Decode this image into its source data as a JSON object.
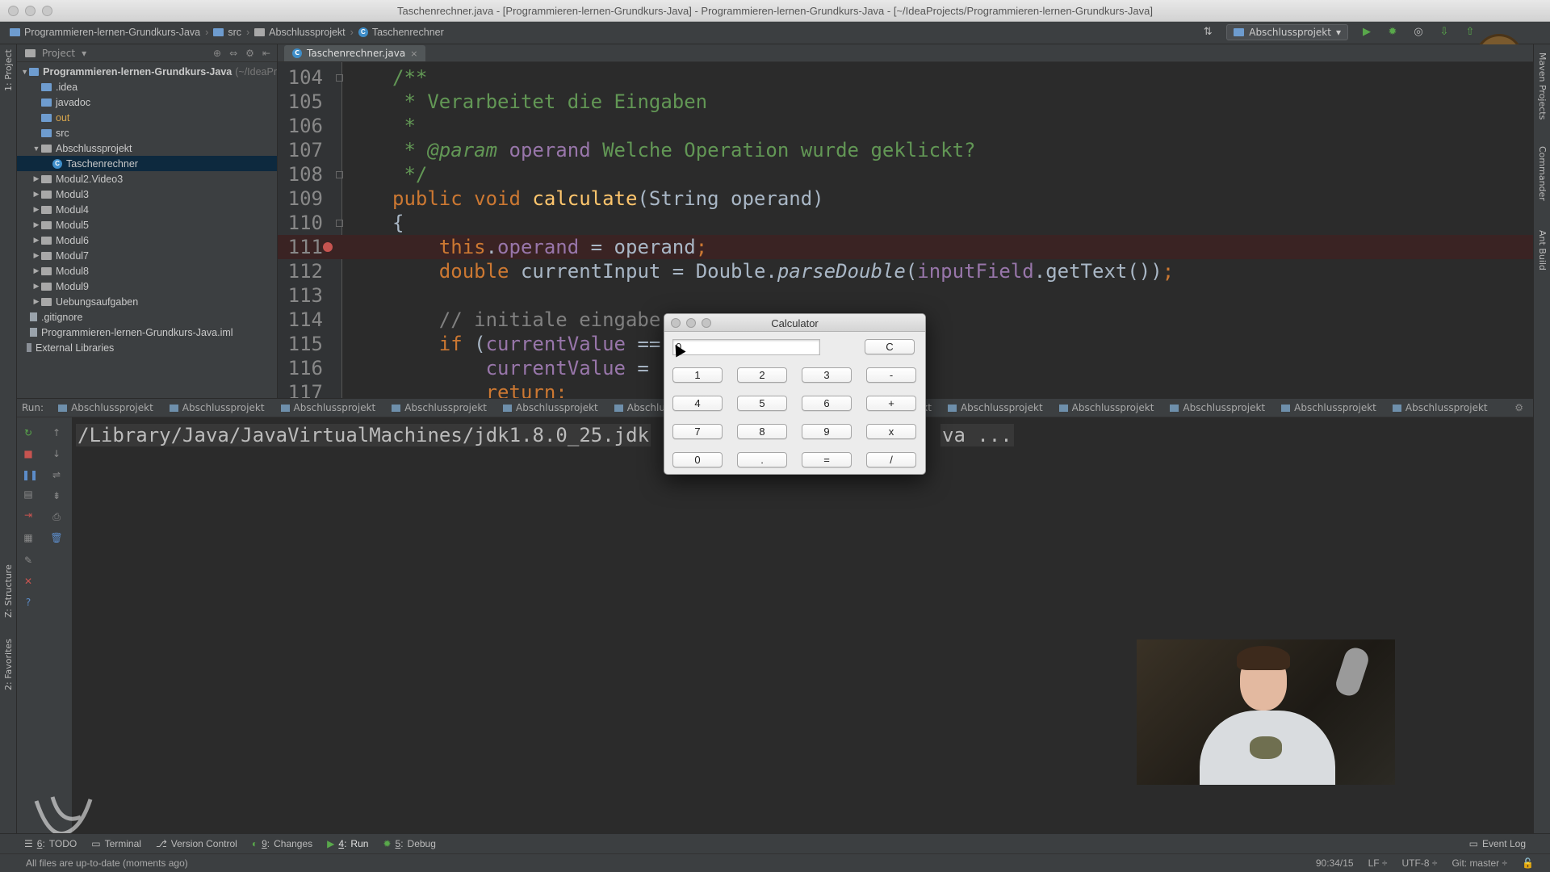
{
  "window": {
    "title": "Taschenrechner.java - [Programmieren-lernen-Grundkurs-Java] - Programmieren-lernen-Grundkurs-Java - [~/IdeaProjects/Programmieren-lernen-Grundkurs-Java]"
  },
  "navbar": {
    "breadcrumbs": [
      "Programmieren-lernen-Grundkurs-Java",
      "src",
      "Abschlussprojekt",
      "Taschenrechner"
    ],
    "run_config": "Abschlussprojekt"
  },
  "tool_strips": {
    "left_top": "1: Project",
    "left_structure": "Z: Structure",
    "left_favorites": "2: Favorites",
    "right": [
      "Maven Projects",
      "Commander",
      "Ant Build"
    ]
  },
  "project_panel": {
    "header": "Project",
    "tree": [
      {
        "label": "Programmieren-lernen-Grundkurs-Java",
        "suffix": "(~/IdeaPr",
        "level": 0,
        "icon": "folder-icon",
        "arrow": "▼"
      },
      {
        "label": ".idea",
        "level": 1,
        "icon": "folder-icon",
        "arrow": ""
      },
      {
        "label": "javadoc",
        "level": 1,
        "icon": "folder-icon",
        "arrow": ""
      },
      {
        "label": "out",
        "level": 1,
        "icon": "folder-icon",
        "arrow": ""
      },
      {
        "label": "src",
        "level": 1,
        "icon": "folder-icon",
        "arrow": ""
      },
      {
        "label": "Abschlussprojekt",
        "level": 1,
        "icon": "package-icon",
        "arrow": "▼"
      },
      {
        "label": "Taschenrechner",
        "level": 2,
        "icon": "class-icon",
        "arrow": "",
        "selected": true
      },
      {
        "label": "Modul2.Video3",
        "level": 1,
        "icon": "package-icon",
        "arrow": "▶"
      },
      {
        "label": "Modul3",
        "level": 1,
        "icon": "package-icon",
        "arrow": "▶"
      },
      {
        "label": "Modul4",
        "level": 1,
        "icon": "package-icon",
        "arrow": "▶"
      },
      {
        "label": "Modul5",
        "level": 1,
        "icon": "package-icon",
        "arrow": "▶"
      },
      {
        "label": "Modul6",
        "level": 1,
        "icon": "package-icon",
        "arrow": "▶"
      },
      {
        "label": "Modul7",
        "level": 1,
        "icon": "package-icon",
        "arrow": "▶"
      },
      {
        "label": "Modul8",
        "level": 1,
        "icon": "package-icon",
        "arrow": "▶"
      },
      {
        "label": "Modul9",
        "level": 1,
        "icon": "package-icon",
        "arrow": "▶"
      },
      {
        "label": "Uebungsaufgaben",
        "level": 1,
        "icon": "package-icon",
        "arrow": "▶"
      },
      {
        "label": ".gitignore",
        "level": 0,
        "icon": "file-icon",
        "arrow": ""
      },
      {
        "label": "Programmieren-lernen-Grundkurs-Java.iml",
        "level": 0,
        "icon": "file-icon",
        "arrow": ""
      },
      {
        "label": "External Libraries",
        "level": -1,
        "icon": "library-icon",
        "arrow": ""
      }
    ]
  },
  "editor": {
    "tab": "Taschenrechner.java",
    "lines": [
      {
        "num": "104",
        "indent": "",
        "fold": true,
        "segments": [
          [
            "c-doc",
            "/**"
          ]
        ]
      },
      {
        "num": "105",
        "indent": " ",
        "fold": false,
        "segments": [
          [
            "c-doc",
            "* Verarbeitet die Eingaben"
          ]
        ]
      },
      {
        "num": "106",
        "indent": " ",
        "fold": false,
        "segments": [
          [
            "c-doc",
            "*"
          ]
        ]
      },
      {
        "num": "107",
        "indent": " ",
        "fold": false,
        "segments": [
          [
            "c-doc",
            "* "
          ],
          [
            "c-doc it",
            "@param"
          ],
          [
            "fld",
            " operand"
          ],
          [
            "c-doc",
            " Welche Operation wurde geklickt?"
          ]
        ]
      },
      {
        "num": "108",
        "indent": " ",
        "fold": true,
        "segments": [
          [
            "c-doc",
            "*/"
          ]
        ]
      },
      {
        "num": "109",
        "indent": "",
        "fold": false,
        "segments": [
          [
            "kw",
            "public void "
          ],
          [
            "fn",
            "calculate"
          ],
          [
            "plain",
            "(String operand)"
          ]
        ]
      },
      {
        "num": "110",
        "indent": "",
        "fold": true,
        "segments": [
          [
            "plain",
            "{"
          ]
        ]
      },
      {
        "num": "111",
        "indent": "    ",
        "fold": false,
        "breakpoint": true,
        "segments": [
          [
            "kw",
            "this"
          ],
          [
            "plain",
            "."
          ],
          [
            "fld",
            "operand"
          ],
          [
            "plain",
            " = operand"
          ],
          [
            "kw",
            ";"
          ]
        ]
      },
      {
        "num": "112",
        "indent": "    ",
        "fold": false,
        "segments": [
          [
            "kw",
            "double "
          ],
          [
            "plain",
            "currentInput = Double."
          ],
          [
            "plain it",
            "parseDouble"
          ],
          [
            "plain",
            "("
          ],
          [
            "fld",
            "inputField"
          ],
          [
            "plain",
            ".getText())"
          ],
          [
            "kw",
            ";"
          ]
        ]
      },
      {
        "num": "113",
        "indent": "",
        "fold": false,
        "segments": []
      },
      {
        "num": "114",
        "indent": "    ",
        "fold": false,
        "segments": [
          [
            "c-cmt",
            "// initiale eingabe"
          ]
        ]
      },
      {
        "num": "115",
        "indent": "    ",
        "fold": false,
        "segments": [
          [
            "kw",
            "if "
          ],
          [
            "plain",
            "("
          ],
          [
            "fld",
            "currentValue"
          ],
          [
            "plain",
            " =="
          ]
        ]
      },
      {
        "num": "116",
        "indent": "        ",
        "fold": false,
        "segments": [
          [
            "fld",
            "currentValue"
          ],
          [
            "plain",
            " ="
          ]
        ]
      },
      {
        "num": "117",
        "indent": "        ",
        "fold": false,
        "segments": [
          [
            "kw",
            "return;"
          ]
        ]
      }
    ]
  },
  "run_panel": {
    "label": "Run:",
    "tabs": [
      "Abschlussprojekt",
      "Abschlussprojekt",
      "Abschlussprojekt",
      "Abschlussprojekt",
      "Abschlussprojekt",
      "Abschlussprojekt",
      "Abschlussprojekt",
      "Abschlussprojekt",
      "Abschlussprojekt",
      "Abschlussprojekt",
      "Abschlussprojekt",
      "Abschlussprojekt",
      "Abschlussprojekt"
    ],
    "console_line_left": "/Library/Java/JavaVirtualMachines/jdk1.8.0_25.jdk",
    "console_line_right": "va ..."
  },
  "calculator": {
    "title": "Calculator",
    "display": "0",
    "clear": "C",
    "keys": [
      [
        "1",
        "2",
        "3",
        "-"
      ],
      [
        "4",
        "5",
        "6",
        "+"
      ],
      [
        "7",
        "8",
        "9",
        "x"
      ],
      [
        "0",
        ".",
        "=",
        "/"
      ]
    ]
  },
  "bottom_bar": {
    "items": [
      {
        "num": "6",
        "label": "TODO",
        "icon": "todo-icon"
      },
      {
        "num": "",
        "label": "Terminal",
        "icon": "terminal-icon"
      },
      {
        "num": "",
        "label": "Version Control",
        "icon": "vcs-icon"
      },
      {
        "num": "9",
        "label": "Changes",
        "icon": "changes-icon"
      },
      {
        "num": "4",
        "label": "Run",
        "icon": "run-icon",
        "active": true
      },
      {
        "num": "5",
        "label": "Debug",
        "icon": "debug-icon"
      }
    ],
    "event_log": "Event Log"
  },
  "status_bar": {
    "message": "All files are up-to-date (moments ago)",
    "position": "90:34/15",
    "line_sep": "LF ÷",
    "encoding": "UTF-8 ÷",
    "git": "Git: master ÷"
  }
}
